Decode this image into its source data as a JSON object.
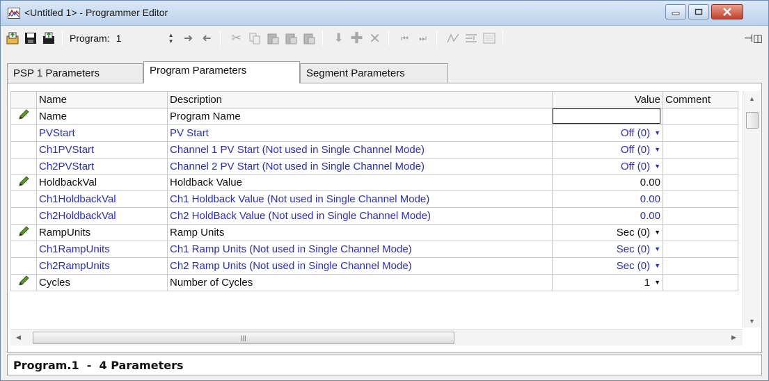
{
  "window": {
    "title": "<Untitled 1> - Programmer Editor"
  },
  "toolbar": {
    "program_label": "Program:",
    "program_value": "1"
  },
  "tabs": [
    {
      "label": "PSP 1 Parameters"
    },
    {
      "label": "Program Parameters",
      "active": true
    },
    {
      "label": "Segment Parameters"
    }
  ],
  "grid": {
    "columns": [
      "Name",
      "Description",
      "Value",
      "Comment"
    ],
    "rows": [
      {
        "name": "Name",
        "description": "Program Name",
        "value": "",
        "editing": true,
        "pencil": true,
        "blue": false
      },
      {
        "name": "PVStart",
        "description": "PV Start",
        "value": "Off (0)",
        "dropdown": true,
        "blue": true
      },
      {
        "name": "Ch1PVStart",
        "description": "Channel 1 PV Start (Not used in Single Channel Mode)",
        "value": "Off (0)",
        "dropdown": true,
        "blue": true
      },
      {
        "name": "Ch2PVStart",
        "description": "Channel 2 PV Start (Not used in Single Channel Mode)",
        "value": "Off (0)",
        "dropdown": true,
        "blue": true
      },
      {
        "name": "HoldbackVal",
        "description": "Holdback Value",
        "value": "0.00",
        "pencil": true,
        "blue": false
      },
      {
        "name": "Ch1HoldbackVal",
        "description": "Ch1 Holdback Value (Not used in Single Channel Mode)",
        "value": "0.00",
        "blue": true
      },
      {
        "name": "Ch2HoldbackVal",
        "description": "Ch2 HoldBack Value (Not used in Single Channel Mode)",
        "value": "0.00",
        "blue": true
      },
      {
        "name": "RampUnits",
        "description": "Ramp Units",
        "value": "Sec (0)",
        "dropdown": true,
        "pencil": true,
        "blue": false
      },
      {
        "name": "Ch1RampUnits",
        "description": "Ch1 Ramp Units (Not used in Single Channel Mode)",
        "value": "Sec (0)",
        "dropdown": true,
        "blue": true
      },
      {
        "name": "Ch2RampUnits",
        "description": "Ch2 Ramp Units (Not used in Single Channel Mode)",
        "value": "Sec (0)",
        "dropdown": true,
        "blue": true
      },
      {
        "name": "Cycles",
        "description": "Number of Cycles",
        "value": "1",
        "dropdown": true,
        "pencil": true,
        "blue": false
      }
    ]
  },
  "status": {
    "text": "Program.1  -  4 Parameters"
  },
  "colors": {
    "blue_text": "#2a2ad6",
    "pencil_green": "#5a9a2a"
  },
  "icons": [
    "app-icon",
    "open-icon",
    "save-icon",
    "save-as-icon",
    "spinner-icon",
    "arrow-right-icon",
    "arrow-left-icon",
    "cut-icon",
    "copy-icon",
    "paste-icon",
    "paste-before-icon",
    "paste-after-icon",
    "insert-down-icon",
    "add-icon",
    "delete-icon",
    "first-icon",
    "last-icon",
    "ramp-icon",
    "align-icon",
    "list-icon",
    "pin-icon",
    "pencil-icon"
  ]
}
